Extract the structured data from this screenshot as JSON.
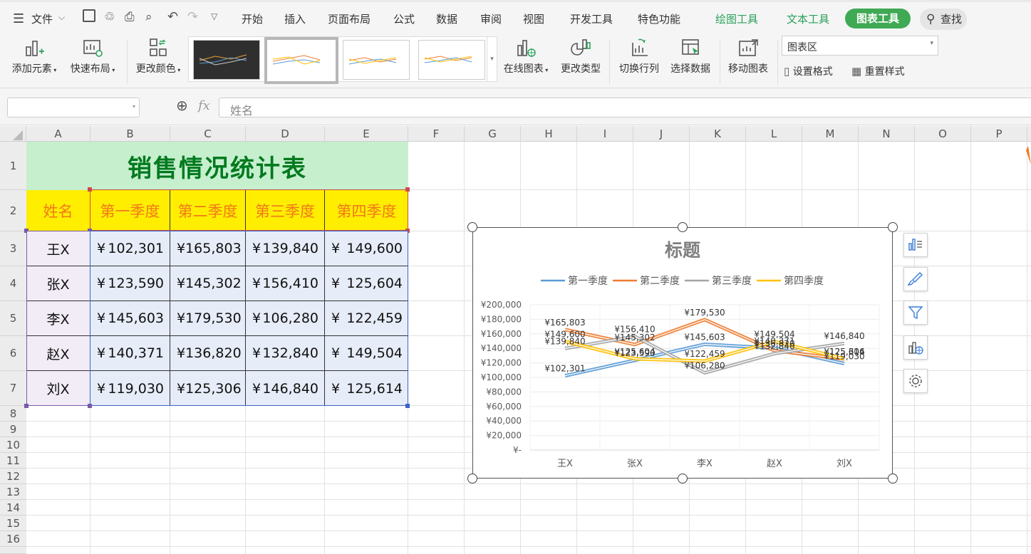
{
  "menubar": {
    "file_label": "文件",
    "tabs": [
      "开始",
      "插入",
      "页面布局",
      "公式",
      "数据",
      "审阅",
      "视图",
      "开发工具",
      "特色功能"
    ],
    "context_tabs": [
      "绘图工具",
      "文本工具"
    ],
    "active_tab": "图表工具",
    "search_label": "查找"
  },
  "ribbon": {
    "add_element": "添加元素",
    "quick_layout": "快速布局",
    "change_color": "更改颜色",
    "online_chart": "在线图表",
    "change_type": "更改类型",
    "switch_row_col": "切换行列",
    "select_data": "选择数据",
    "move_chart": "移动图表",
    "chart_area_select": "图表区",
    "format_settings": "设置格式",
    "reset_style": "重置样式"
  },
  "formula_bar": {
    "name_box": "",
    "fx": "fx",
    "formula": "姓名"
  },
  "columns": [
    "A",
    "B",
    "C",
    "D",
    "E",
    "F",
    "G",
    "H",
    "I",
    "J",
    "K",
    "L",
    "M",
    "N",
    "O",
    "P"
  ],
  "rows": [
    "1",
    "2",
    "3",
    "4",
    "5",
    "6",
    "7",
    "8",
    "9",
    "10",
    "11",
    "12",
    "13",
    "14",
    "15",
    "16"
  ],
  "sheet": {
    "title": "销售情况统计表",
    "headers": [
      "姓名",
      "第一季度",
      "第二季度",
      "第三季度",
      "第四季度"
    ],
    "currency_symbol": "¥",
    "data": [
      {
        "name": "王X",
        "q": [
          "102,301",
          "165,803",
          "139,840",
          "149,600"
        ]
      },
      {
        "name": "张X",
        "q": [
          "123,590",
          "145,302",
          "156,410",
          "125,604"
        ]
      },
      {
        "name": "李X",
        "q": [
          "145,603",
          "179,530",
          "106,280",
          "122,459"
        ]
      },
      {
        "name": "赵X",
        "q": [
          "140,371",
          "136,820",
          "132,840",
          "149,504"
        ]
      },
      {
        "name": "刘X",
        "q": [
          "119,030",
          "125,306",
          "146,840",
          "125,614"
        ]
      }
    ],
    "colors": {
      "title_bg": "#c6efce",
      "title_text": "#007a1f",
      "header_bg": "#ffee00",
      "header_text": "#f07a1a",
      "name_bg": "#f1ecf6",
      "value_bg": "#e6ecf8"
    }
  },
  "chart_data": {
    "type": "line",
    "title": "标题",
    "categories": [
      "王X",
      "张X",
      "李X",
      "赵X",
      "刘X"
    ],
    "ylim": [
      0,
      200000
    ],
    "yticks": [
      "¥-",
      "¥20,000",
      "¥40,000",
      "¥60,000",
      "¥80,000",
      "¥100,000",
      "¥120,000",
      "¥140,000",
      "¥160,000",
      "¥180,000",
      "¥200,000"
    ],
    "legend_position": "top",
    "grid": true,
    "series": [
      {
        "name": "第一季度",
        "color": "#5b9bd5",
        "values": [
          102301,
          123590,
          145603,
          140371,
          119030
        ],
        "labels": [
          "¥102,301",
          "¥123,590",
          "¥145,603",
          "¥140,371",
          "¥119,030"
        ]
      },
      {
        "name": "第二季度",
        "color": "#ed7d31",
        "values": [
          165803,
          145302,
          179530,
          136820,
          125306
        ],
        "labels": [
          "¥165,803",
          "¥145,302",
          "¥179,530",
          "¥136,820",
          "¥125,306"
        ]
      },
      {
        "name": "第三季度",
        "color": "#a5a5a5",
        "values": [
          139840,
          156410,
          106280,
          132840,
          146840
        ],
        "labels": [
          "¥139,840",
          "¥156,410",
          "¥106,280",
          "¥132,840",
          "¥146,840"
        ]
      },
      {
        "name": "第四季度",
        "color": "#ffc000",
        "values": [
          149600,
          125604,
          122459,
          149504,
          125614
        ],
        "labels": [
          "¥149,600",
          "¥125,604",
          "¥122,459",
          "¥149,504",
          "¥125,614"
        ]
      }
    ]
  }
}
